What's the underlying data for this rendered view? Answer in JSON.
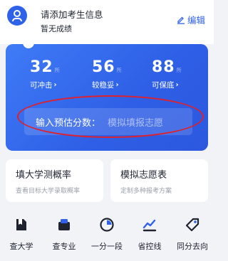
{
  "header": {
    "title": "请添加考生信息",
    "subtitle": "暂无成绩",
    "edit_label": "编辑"
  },
  "stats": [
    {
      "value": "32",
      "unit": "所",
      "label": "可冲击"
    },
    {
      "value": "56",
      "unit": "所",
      "label": "较稳妥"
    },
    {
      "value": "88",
      "unit": "所",
      "label": "可保底"
    }
  ],
  "score_input": {
    "label": "输入预估分数：",
    "placeholder": "模拟填报志愿"
  },
  "features": [
    {
      "title": "填大学测概率",
      "subtitle": "查看目标大学录取概率"
    },
    {
      "title": "模拟志愿表",
      "subtitle": "定制多种报考方案"
    }
  ],
  "bottom_nav": [
    {
      "label": "查大学",
      "icon": "university-icon"
    },
    {
      "label": "查专业",
      "icon": "major-icon"
    },
    {
      "label": "一分一段",
      "icon": "score-segment-icon"
    },
    {
      "label": "省控线",
      "icon": "control-line-icon"
    },
    {
      "label": "同分去向",
      "icon": "same-score-icon"
    }
  ],
  "colors": {
    "primary": "#2f62e8",
    "highlight": "#e0202a",
    "background": "#f2f3f7"
  }
}
